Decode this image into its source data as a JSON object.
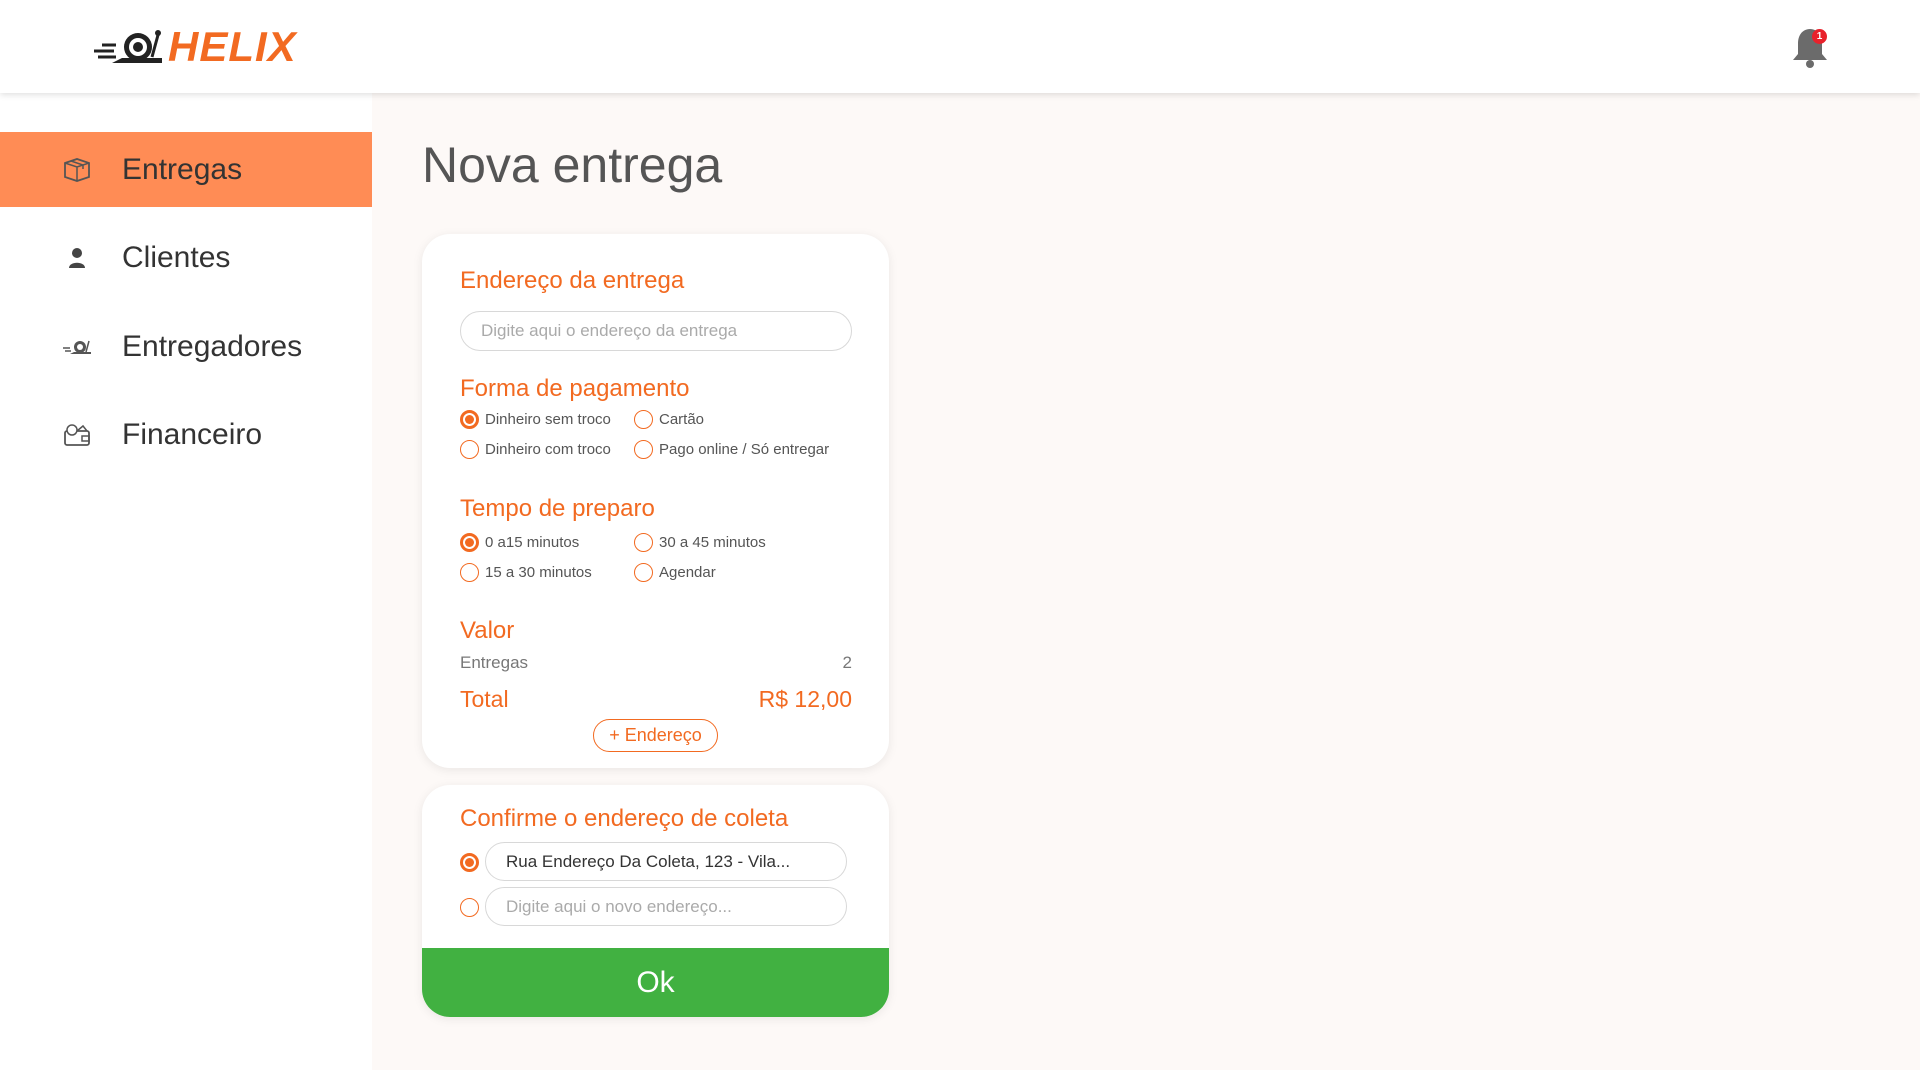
{
  "brand": {
    "name": "HELIX",
    "accent": "#f26a21",
    "notification_count": "1"
  },
  "sidebar": {
    "items": [
      {
        "label": "Entregas",
        "icon": "box-icon",
        "active": true
      },
      {
        "label": "Clientes",
        "icon": "person-icon",
        "active": false
      },
      {
        "label": "Entregadores",
        "icon": "snail-icon",
        "active": false
      },
      {
        "label": "Financeiro",
        "icon": "wallet-icon",
        "active": false
      }
    ]
  },
  "page": {
    "title": "Nova entrega"
  },
  "form": {
    "address": {
      "title": "Endereço da entrega",
      "placeholder": "Digite aqui o endereço da entrega",
      "value": ""
    },
    "payment": {
      "title": "Forma de pagamento",
      "options": [
        "Dinheiro sem troco",
        "Cartão",
        "Dinheiro com troco",
        "Pago online / Só entregar"
      ],
      "selected": "Dinheiro sem troco"
    },
    "prep_time": {
      "title": "Tempo de preparo",
      "options": [
        "0 a15 minutos",
        "30 a 45 minutos",
        "15 a 30 minutos",
        "Agendar"
      ],
      "selected": "0 a15 minutos"
    },
    "valor": {
      "title": "Valor",
      "entregas_label": "Entregas",
      "entregas_count": "2",
      "total_label": "Total",
      "total_value": "R$ 12,00"
    },
    "add_address_label": "+ Endereço"
  },
  "pickup": {
    "title": "Confirme o endereço de coleta",
    "current_address": "Rua Endereço Da Coleta, 123 - Vila...",
    "new_placeholder": "Digite aqui o novo endereço...",
    "selected": "current"
  },
  "ok_label": "Ok",
  "colors": {
    "primary": "#f26a21",
    "sidebar_active": "#ff8c55",
    "confirm": "#41b141",
    "badge": "#e8212b"
  }
}
